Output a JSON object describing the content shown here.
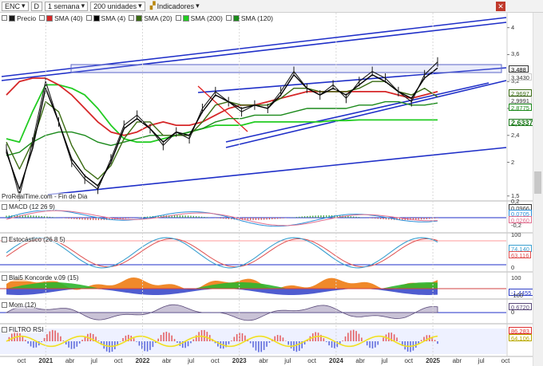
{
  "toolbar": {
    "ticker": "ENC",
    "d_label": "D",
    "period": "1 semana",
    "units": "200 unidades",
    "indicators": "Indicadores"
  },
  "legend": [
    {
      "label": "Precio",
      "color": "#1a1a1a"
    },
    {
      "label": "SMA (40)",
      "color": "#d62728"
    },
    {
      "label": "SMA (4)",
      "color": "#000000"
    },
    {
      "label": "SMA (20)",
      "color": "#3a6b12"
    },
    {
      "label": "SMA (200)",
      "color": "#22cc22"
    },
    {
      "label": "SMA (120)",
      "color": "#1b8a1b"
    }
  ],
  "watermark": "ProRealTime.com - Fin de Dia",
  "panels": {
    "macd": {
      "label": "MACD (12 26 9)",
      "values": [
        "0,0966",
        "0,0705",
        "0,0260"
      ],
      "ticks": [
        "0,2",
        "-0,2"
      ]
    },
    "stoch": {
      "label": "Estocástico (26 8 5)",
      "values": [
        "74,140",
        "63,116"
      ],
      "ticks": [
        "100",
        "0"
      ]
    },
    "konc": {
      "label": "Blai5 Koncorde v.09 (15)",
      "values": [
        "-1,4455"
      ],
      "ticks": [
        "100",
        "-100"
      ]
    },
    "mom": {
      "label": "Mom (12)",
      "values": [
        "0,6720"
      ],
      "ticks": [
        "0"
      ]
    },
    "rsi": {
      "label": "FILTRO RSI",
      "values": [
        "86,283",
        "64,106"
      ]
    }
  },
  "price_tags": [
    {
      "text": "3,488",
      "bg": "#ffffff",
      "fg": "#000000",
      "border": "#333333"
    },
    {
      "text": "3,3430",
      "bg": "#ffffff",
      "fg": "#333333",
      "border": "#cccccc"
    },
    {
      "text": "2,9697",
      "bg": "#ffffff",
      "fg": "#3a6b12",
      "border": "#3a6b12"
    },
    {
      "text": "2,9991",
      "bg": "#ffffff",
      "fg": "#333333",
      "border": "#cccccc"
    },
    {
      "text": "2,8775",
      "bg": "#ffffff",
      "fg": "#1b8a1b",
      "border": "#1b8a1b"
    },
    {
      "text": "2,6337",
      "bg": "#ffffff",
      "fg": "#1b7a1b",
      "border": "#1b7a1b"
    }
  ],
  "y_axis_labels": [
    "4",
    "3,6",
    "3,2",
    "2,8",
    "2,4",
    "2",
    "1,5"
  ],
  "x_axis_labels": [
    {
      "text": "oct",
      "year": false
    },
    {
      "text": "2021",
      "year": true
    },
    {
      "text": "abr",
      "year": false
    },
    {
      "text": "jul",
      "year": false
    },
    {
      "text": "oct",
      "year": false
    },
    {
      "text": "2022",
      "year": true
    },
    {
      "text": "abr",
      "year": false
    },
    {
      "text": "jul",
      "year": false
    },
    {
      "text": "oct",
      "year": false
    },
    {
      "text": "2023",
      "year": true
    },
    {
      "text": "abr",
      "year": false
    },
    {
      "text": "jul",
      "year": false
    },
    {
      "text": "oct",
      "year": false
    },
    {
      "text": "2024",
      "year": true
    },
    {
      "text": "abr",
      "year": false
    },
    {
      "text": "jul",
      "year": false
    },
    {
      "text": "oct",
      "year": false
    },
    {
      "text": "2025",
      "year": true
    },
    {
      "text": "abr",
      "year": false
    },
    {
      "text": "jul",
      "year": false
    },
    {
      "text": "oct",
      "year": false
    }
  ],
  "chart_data": {
    "type": "line",
    "title": "",
    "ylim": [
      1.45,
      4.15
    ],
    "grid": false,
    "x_start": "2020-09",
    "x_end": "2025-10",
    "series": [
      {
        "name": "Precio",
        "color": "#1a1a1a",
        "values": [
          2.2,
          1.5,
          2.3,
          3.2,
          2.6,
          2.0,
          1.75,
          1.6,
          2.05,
          2.55,
          2.7,
          2.5,
          2.25,
          2.45,
          2.35,
          2.8,
          3.05,
          2.9,
          2.75,
          2.85,
          2.8,
          3.05,
          3.35,
          3.1,
          3.0,
          3.15,
          2.95,
          3.2,
          3.35,
          3.25,
          3.05,
          2.9,
          3.3,
          3.49
        ]
      },
      {
        "name": "SMA (40)",
        "color": "#d62728",
        "values": [
          3.0,
          3.2,
          3.25,
          3.25,
          3.15,
          3.0,
          2.8,
          2.6,
          2.45,
          2.4,
          2.45,
          2.55,
          2.6,
          2.55,
          2.55,
          2.6,
          2.7,
          2.8,
          2.85,
          2.85,
          2.9,
          2.95,
          3.0,
          3.05,
          3.05,
          3.05,
          3.05,
          3.05,
          3.05,
          3.05,
          3.0,
          2.95,
          3.0,
          3.05
        ]
      },
      {
        "name": "SMA (4)",
        "color": "#000000",
        "values": [
          2.15,
          1.6,
          2.2,
          3.1,
          2.6,
          2.05,
          1.8,
          1.65,
          2.0,
          2.5,
          2.65,
          2.5,
          2.3,
          2.45,
          2.4,
          2.75,
          3.0,
          2.9,
          2.8,
          2.85,
          2.8,
          3.0,
          3.3,
          3.1,
          3.0,
          3.1,
          3.0,
          3.15,
          3.3,
          3.2,
          3.05,
          2.95,
          3.25,
          3.4
        ]
      },
      {
        "name": "SMA (20)",
        "color": "#3a6b12",
        "values": [
          2.3,
          1.9,
          2.3,
          2.9,
          2.75,
          2.25,
          1.9,
          1.75,
          1.95,
          2.35,
          2.6,
          2.6,
          2.4,
          2.4,
          2.4,
          2.6,
          2.85,
          2.9,
          2.85,
          2.85,
          2.85,
          2.95,
          3.1,
          3.1,
          3.05,
          3.05,
          3.05,
          3.1,
          3.2,
          3.2,
          3.05,
          3.0,
          3.1,
          2.97
        ]
      },
      {
        "name": "SMA (200)",
        "color": "#22cc22",
        "values": [
          2.35,
          2.3,
          2.75,
          3.15,
          3.15,
          3.1,
          3.0,
          2.8,
          2.55,
          2.35,
          2.3,
          2.3,
          2.35,
          2.4,
          2.45,
          2.5,
          2.55,
          2.55,
          2.55,
          2.6,
          2.6,
          2.6,
          2.6,
          2.6,
          2.6,
          2.62,
          2.62,
          2.63,
          2.63,
          2.63,
          2.63,
          2.63,
          2.63,
          2.63
        ]
      },
      {
        "name": "SMA (120)",
        "color": "#1b8a1b",
        "values": [
          2.1,
          2.15,
          2.3,
          2.4,
          2.45,
          2.45,
          2.4,
          2.3,
          2.25,
          2.3,
          2.35,
          2.4,
          2.4,
          2.4,
          2.45,
          2.5,
          2.6,
          2.65,
          2.65,
          2.7,
          2.7,
          2.7,
          2.75,
          2.8,
          2.8,
          2.8,
          2.8,
          2.85,
          2.85,
          2.9,
          2.9,
          2.85,
          2.85,
          2.88
        ]
      }
    ]
  }
}
